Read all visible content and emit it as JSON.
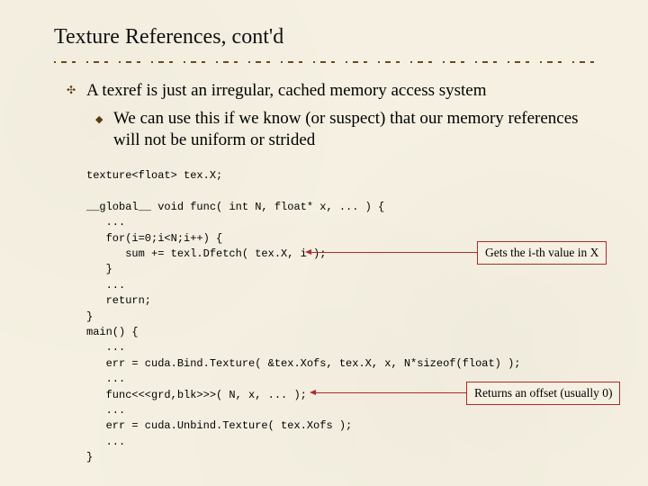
{
  "title": "Texture References, cont'd",
  "bullet1": "A texref is just an irregular, cached memory access system",
  "bullet2": "We can use this if we know (or suspect) that our memory references will not be uniform or strided",
  "code": {
    "l01": "texture<float> tex.X;",
    "l02": "",
    "l03": "__global__ void func( int N, float* x, ... ) {",
    "l04": "   ...",
    "l05": "   for(i=0;i<N;i++) {",
    "l06": "      sum += texl.Dfetch( tex.X, i );",
    "l07": "   }",
    "l08": "   ...",
    "l09": "   return;",
    "l10": "}",
    "l11": "main() {",
    "l12": "   ...",
    "l13": "   err = cuda.Bind.Texture( &tex.Xofs, tex.X, x, N*sizeof(float) );",
    "l14": "   ...",
    "l15": "   func<<<grd,blk>>>( N, x, ... );",
    "l16": "   ...",
    "l17": "   err = cuda.Unbind.Texture( tex.Xofs );",
    "l18": "   ...",
    "l19": "}"
  },
  "callout1": "Gets the i-th value in X",
  "callout2": "Returns an offset (usually 0)",
  "colors": {
    "accent_border": "#b2292b",
    "bullet": "#5a3a10",
    "bg": "#f5f0e1"
  }
}
